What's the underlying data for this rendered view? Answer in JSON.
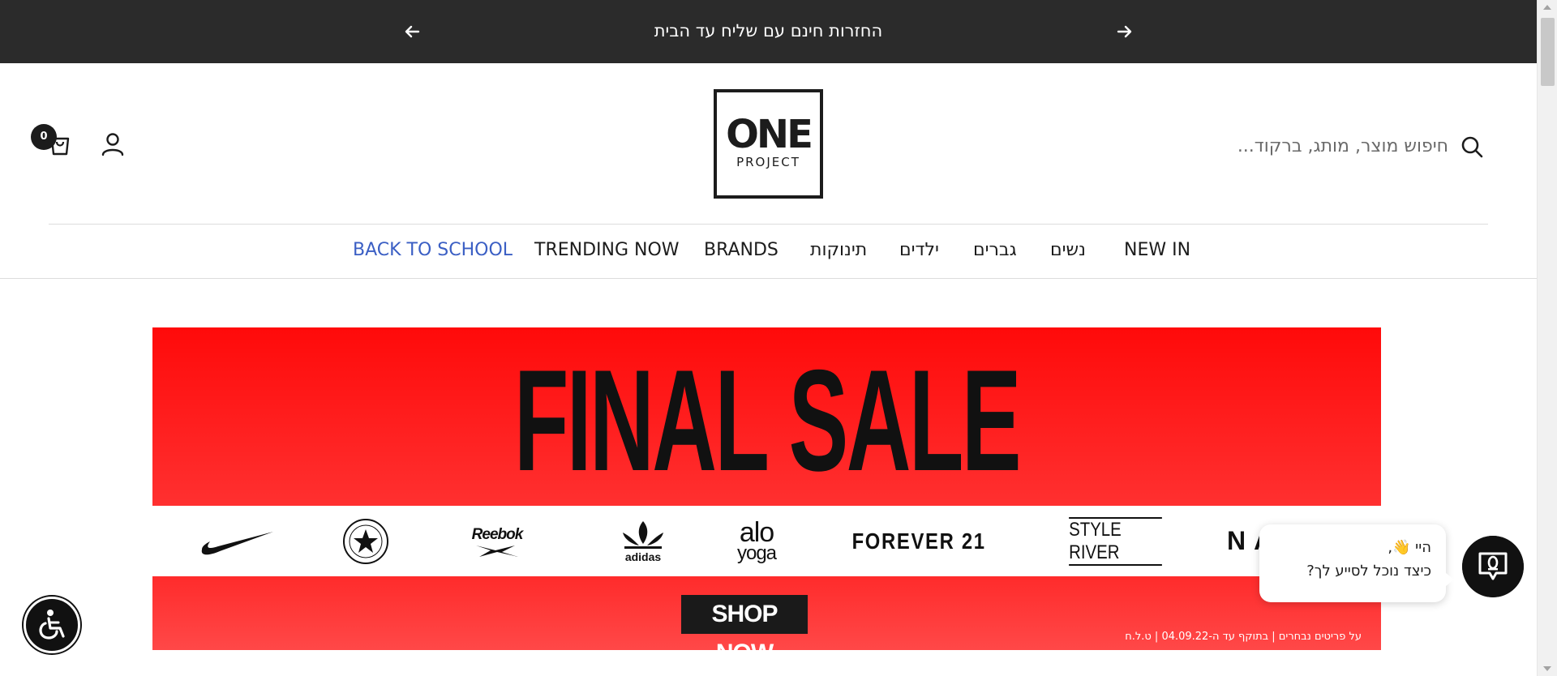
{
  "announcement": {
    "text": "החזרות חינם עם שליח עד הבית",
    "prev_icon": "arrow-left-icon",
    "next_icon": "arrow-right-icon"
  },
  "header": {
    "cart_count": "0",
    "logo_top": "ONE",
    "logo_bottom": "PROJECT",
    "search_placeholder": "חיפוש מוצר, מותג, ברקוד..."
  },
  "nav": {
    "items": [
      {
        "label": "NEW IN"
      },
      {
        "label": "נשים"
      },
      {
        "label": "גברים"
      },
      {
        "label": "ילדים"
      },
      {
        "label": "תינוקות"
      },
      {
        "label": "BRANDS"
      },
      {
        "label": "TRENDING NOW"
      },
      {
        "label": "BACK TO SCHOOL",
        "color": "#3b5fc4"
      }
    ]
  },
  "banner": {
    "headline": "FINAL SALE",
    "brands": [
      "nike",
      "CONVERSE ALL STAR",
      "Reebok",
      "adidas",
      "alo yoga",
      "FOREVER 21",
      "STYLE RIVER",
      "NA"
    ],
    "cta": "SHOP NOW",
    "fine_print": "על פריטים נבחרים | בתוקף עד ה-04.09.22 | ט.ל.ח"
  },
  "chat": {
    "greeting": "היי 👋,",
    "question": "כיצד נוכל לסייע לך?"
  },
  "colors": {
    "announcement_bg": "#2b2b2b",
    "banner_red": "#ff0a0a",
    "accent_blue": "#3b5fc4"
  }
}
